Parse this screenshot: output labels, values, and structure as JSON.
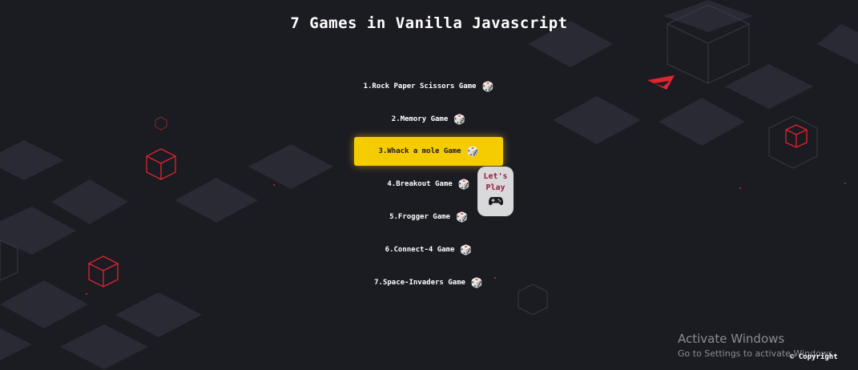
{
  "title": "7 Games in Vanilla Javascript",
  "menu": {
    "items": [
      {
        "label": "1.Rock Paper Scissors Game"
      },
      {
        "label": "2.Memory Game"
      },
      {
        "label": "3.Whack a mole Game"
      },
      {
        "label": "4.Breakout Game"
      },
      {
        "label": "5.Frogger Game"
      },
      {
        "label": "6.Connect-4 Game"
      },
      {
        "label": "7.Space-Invaders Game"
      }
    ],
    "active_index": 2,
    "item_icon": "dice-icon"
  },
  "tooltip": {
    "line1": "Let's",
    "line2": "Play",
    "icon": "gamepad-icon"
  },
  "watermark": {
    "line1": "Activate Windows",
    "line2": "Go to Settings to activate Windows."
  },
  "footer": {
    "copyright_symbol": "©",
    "copyright_label": "Copyright"
  },
  "colors": {
    "background": "#1b1b22",
    "tile": "#2a2a34",
    "accent": "#f5cc00",
    "cube_outline": "#e0242f",
    "tooltip_bg": "#d9d9dc",
    "tooltip_text": "#9b1b3a"
  }
}
